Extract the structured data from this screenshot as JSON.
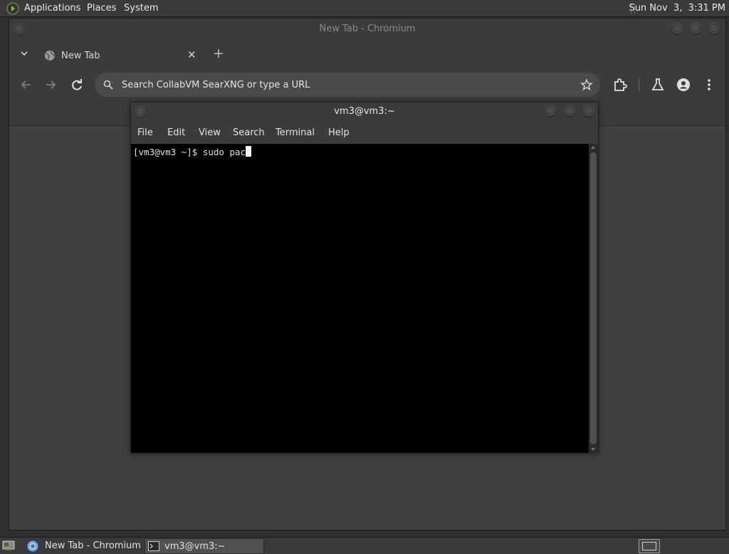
{
  "top_panel": {
    "menus": [
      "Applications",
      "Places",
      "System"
    ],
    "clock": "Sun Nov  3,  3:31 PM"
  },
  "browser": {
    "window_title": "New Tab - Chromium",
    "tab": {
      "label": "New Tab"
    },
    "omnibox": {
      "placeholder": "Search CollabVM SearXNG or type a URL",
      "value": ""
    }
  },
  "terminal": {
    "window_title": "vm3@vm3:~",
    "menu": [
      "File",
      "Edit",
      "View",
      "Search",
      "Terminal",
      "Help"
    ],
    "prompt": "[vm3@vm3 ~]$ ",
    "command": "sudo pac"
  },
  "taskbar": {
    "tasks": [
      {
        "label": "New Tab - Chromium",
        "icon": "chromium-icon",
        "active": false
      },
      {
        "label": "vm3@vm3:~",
        "icon": "terminal-icon",
        "active": true
      }
    ]
  },
  "colors": {
    "panel": "#3a3a3c",
    "window": "#3b3b3d",
    "terminal_bg": "#000000",
    "content": "#404042"
  }
}
